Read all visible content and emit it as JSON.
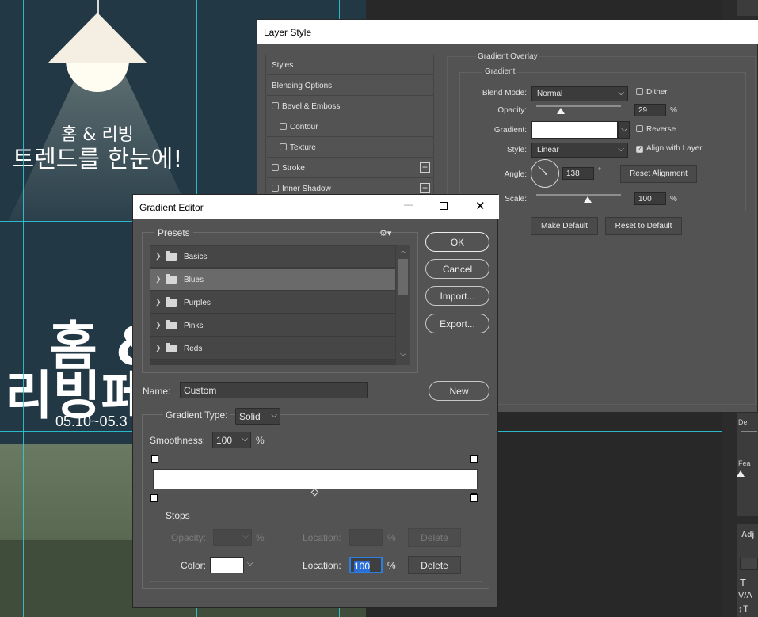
{
  "canvas": {
    "text_line1": "홈 & 리빙",
    "text_line2": "트렌드를 한눈에!",
    "big_line1": "홈 &",
    "big_line2": "리빙페",
    "date": "05.10~05.3"
  },
  "layer_style": {
    "title": "Layer Style",
    "left_items": [
      "Styles",
      "Blending Options",
      "Bevel & Emboss",
      "Contour",
      "Texture",
      "Stroke",
      "Inner Shadow"
    ],
    "group_title": "Gradient Overlay",
    "subgroup_title": "Gradient",
    "blend_mode_label": "Blend Mode:",
    "blend_mode_value": "Normal",
    "dither_label": "Dither",
    "opacity_label": "Opacity:",
    "opacity_value": "29",
    "percent": "%",
    "gradient_label": "Gradient:",
    "reverse_label": "Reverse",
    "style_label": "Style:",
    "style_value": "Linear",
    "align_label": "Align with Layer",
    "angle_label": "Angle:",
    "angle_value": "138",
    "degree": "°",
    "reset_alignment": "Reset Alignment",
    "scale_label": "Scale:",
    "scale_value": "100",
    "make_default": "Make Default",
    "reset_default": "Reset to Default",
    "opacity_fraction": 0.29,
    "scale_fraction": 0.5
  },
  "gradient_editor": {
    "title": "Gradient Editor",
    "presets_label": "Presets",
    "presets": [
      "Basics",
      "Blues",
      "Purples",
      "Pinks",
      "Reds"
    ],
    "selected_preset": "Blues",
    "buttons": {
      "ok": "OK",
      "cancel": "Cancel",
      "import": "Import...",
      "export": "Export...",
      "new": "New"
    },
    "name_label": "Name:",
    "name_value": "Custom",
    "gradient_type_label": "Gradient Type:",
    "gradient_type_value": "Solid",
    "smoothness_label": "Smoothness:",
    "smoothness_value": "100",
    "percent": "%",
    "stops_label": "Stops",
    "opacity_label": "Opacity:",
    "location_label": "Location:",
    "delete_label": "Delete",
    "color_label": "Color:",
    "color_location_value": "100",
    "gradient_color": "#ffffff"
  },
  "right_panel": {
    "labels": [
      "De",
      "Fea",
      "Adj"
    ]
  }
}
